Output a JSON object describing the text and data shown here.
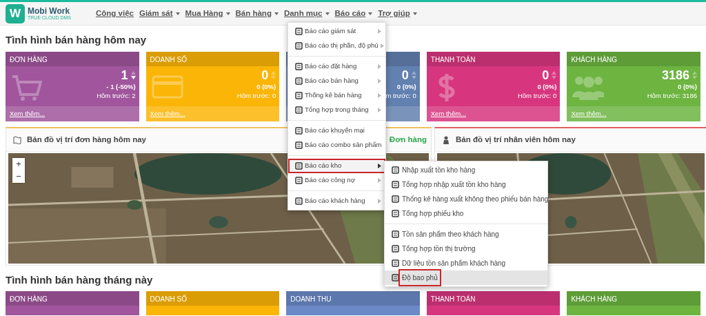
{
  "brand": {
    "logo_letter": "W",
    "name": "Mobi Work",
    "tagline": "TRUE CLOUD DMS"
  },
  "nav": [
    {
      "label": "Công việc",
      "has_caret": false
    },
    {
      "label": "Giám sát",
      "has_caret": true
    },
    {
      "label": "Mua Hàng",
      "has_caret": true
    },
    {
      "label": "Bán hàng",
      "has_caret": true
    },
    {
      "label": "Danh mục",
      "has_caret": true
    },
    {
      "label": "Báo cáo",
      "has_caret": true
    },
    {
      "label": "Trợ giúp",
      "has_caret": true
    }
  ],
  "today": {
    "title": "Tình hình bán hàng hôm nay",
    "cards": [
      {
        "kind": "cart",
        "color": "#a0559c",
        "title": "ĐƠN HÀNG",
        "value": "1",
        "falling": true,
        "change": "- 1 (-50%)",
        "previous": "Hôm trước: 2",
        "more": "Xem thêm..."
      },
      {
        "kind": "card",
        "color": "#fbb507",
        "title": "DOANH SỐ",
        "value": "0",
        "falling": false,
        "change": "0 (0%)",
        "previous": "Hôm trước: 0",
        "more": "Xem thêm..."
      },
      {
        "kind": "none",
        "color": "#6280b0",
        "value": "0",
        "falling": false,
        "change": "0 (0%)",
        "previous": "m trước: 0"
      },
      {
        "kind": "dollar",
        "color": "#d7367f",
        "title": "THANH TOÁN",
        "value": "0",
        "falling": false,
        "change": "0 (0%)",
        "previous": "Hôm trước: 0",
        "more": "Xem thêm..."
      },
      {
        "kind": "people",
        "color": "#6db441",
        "title": "KHÁCH HÀNG",
        "value": "3186",
        "falling": false,
        "change": "0 (0%)",
        "previous": "Hôm trước: 3186",
        "more": "Xem thêm..."
      }
    ]
  },
  "maps": [
    {
      "title": "Bản đồ vị trí đơn hàng hôm nay",
      "tab": "Đơn hàng",
      "controls": [
        "+",
        "−"
      ]
    },
    {
      "title": "Bản đồ vị trí nhân viên hôm nay"
    }
  ],
  "month": {
    "title": "Tình hình bán hàng tháng này",
    "cards": [
      {
        "color": "#a0559c",
        "title": "ĐƠN HÀNG"
      },
      {
        "color": "#fbb507",
        "title": "DOANH SỐ"
      },
      {
        "color": "#6a89c6",
        "title": "DOANH THU"
      },
      {
        "color": "#d7367f",
        "title": "THANH TOÁN"
      },
      {
        "color": "#6db441",
        "title": "KHÁCH HÀNG"
      }
    ]
  },
  "menu": {
    "groups": [
      [
        {
          "label": "Báo cáo giám sát",
          "submenu": true,
          "selected": false
        },
        {
          "label": "Báo cáo thị phần, độ phủ",
          "submenu": true,
          "selected": false
        }
      ],
      [
        {
          "label": "Báo cáo đặt hàng",
          "submenu": true,
          "selected": false
        },
        {
          "label": "Báo cáo bán hàng",
          "submenu": true,
          "selected": false
        },
        {
          "label": "Thống kê bán hàng",
          "submenu": true,
          "selected": false
        },
        {
          "label": "Tổng hợp trong tháng",
          "submenu": true,
          "selected": false
        }
      ],
      [
        {
          "label": "Báo cáo khuyến mại",
          "submenu": false,
          "selected": false
        },
        {
          "label": "Báo cáo combo sản phẩm",
          "submenu": false,
          "selected": false
        }
      ],
      [
        {
          "label": "Báo cáo kho",
          "submenu": true,
          "selected": true
        },
        {
          "label": "Báo cáo công nợ",
          "submenu": true,
          "selected": false
        }
      ],
      [
        {
          "label": "Báo cáo khách hàng",
          "submenu": true,
          "selected": false
        }
      ]
    ]
  },
  "submenu": {
    "groups": [
      [
        {
          "label": "Nhập xuất tồn kho hàng",
          "selected": false
        },
        {
          "label": "Tổng hợp nhập xuất tồn kho hàng",
          "selected": false
        },
        {
          "label": "Thống kê hàng xuất không theo phiếu bán hàng",
          "selected": false
        },
        {
          "label": "Tổng hợp phiếu kho",
          "selected": false
        }
      ],
      [
        {
          "label": "Tồn sản phẩm theo khách hàng",
          "selected": false
        },
        {
          "label": "Tổng hợp tồn thị trường",
          "selected": false
        },
        {
          "label": "Dữ liệu tồn sản phẩm khách hàng",
          "selected": false
        },
        {
          "label": "Độ bao phủ",
          "selected": true
        }
      ]
    ]
  }
}
